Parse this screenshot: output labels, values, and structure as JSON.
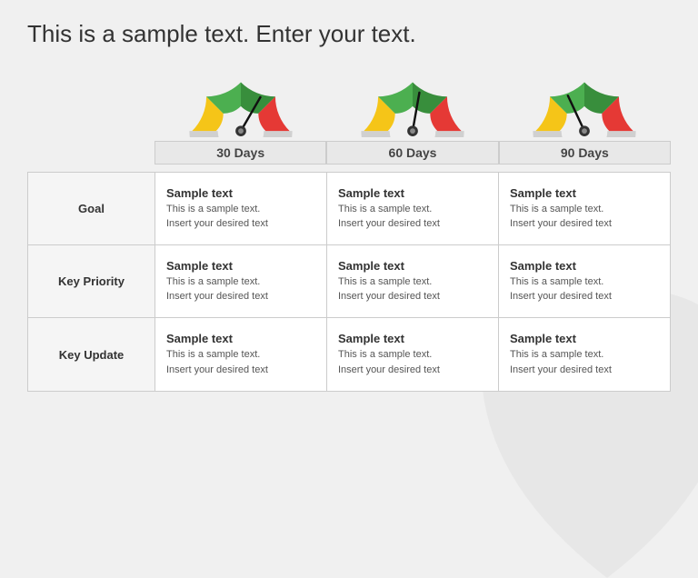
{
  "title": "This is a sample text. Enter your text.",
  "gauges": [
    {
      "label": "30 Days",
      "needle_angle": -30
    },
    {
      "label": "60 Days",
      "needle_angle": -10
    },
    {
      "label": "90 Days",
      "needle_angle": 25
    }
  ],
  "rows": [
    {
      "label": "Goal",
      "cells": [
        {
          "title": "Sample text",
          "body": "This is a sample text.\nInsert your desired text"
        },
        {
          "title": "Sample text",
          "body": "This is a sample text.\nInsert your desired text"
        },
        {
          "title": "Sample text",
          "body": "This is a sample text.\nInsert your desired text"
        }
      ]
    },
    {
      "label": "Key Priority",
      "cells": [
        {
          "title": "Sample text",
          "body": "This is a sample text.\nInsert your desired text"
        },
        {
          "title": "Sample text",
          "body": "This is a sample text.\nInsert your desired text"
        },
        {
          "title": "Sample text",
          "body": "This is a sample text.\nInsert your desired text"
        }
      ]
    },
    {
      "label": "Key Update",
      "cells": [
        {
          "title": "Sample text",
          "body": "This is a sample text.\nInsert your desired text"
        },
        {
          "title": "Sample text",
          "body": "This is a sample text.\nInsert your desired text"
        },
        {
          "title": "Sample text",
          "body": "This is a sample text.\nInsert your desired text"
        }
      ]
    }
  ]
}
